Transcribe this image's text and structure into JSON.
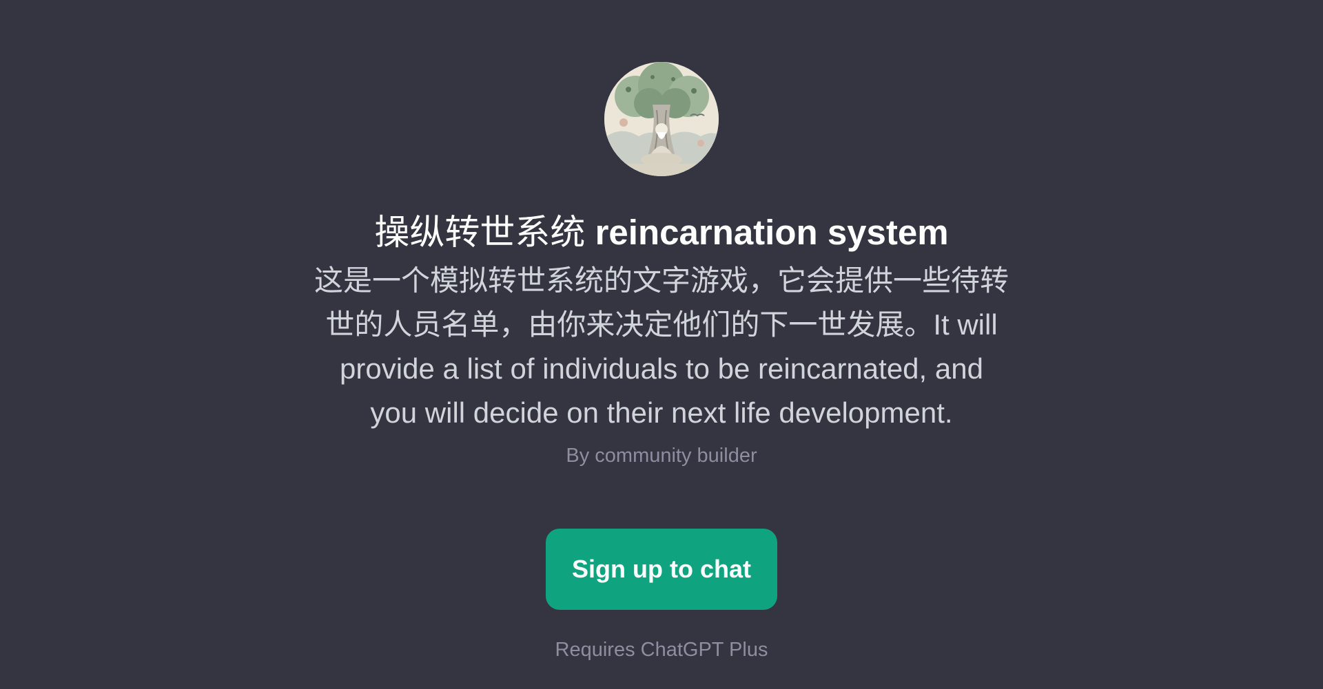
{
  "gpt": {
    "avatar_icon": "meditating-sage-under-tree-icon",
    "title_cn": "操纵转世系统",
    "title_en": "reincarnation system",
    "description": "这是一个模拟转世系统的文字游戏，它会提供一些待转世的人员名单，由你来决定他们的下一世发展。It will provide a list of individuals to be reincarnated, and you will decide on their next life development.",
    "byline": "By community builder"
  },
  "actions": {
    "signup_label": "Sign up to chat"
  },
  "footer": {
    "text": "Requires ChatGPT Plus"
  },
  "colors": {
    "background": "#343541",
    "accent": "#10a37f"
  }
}
